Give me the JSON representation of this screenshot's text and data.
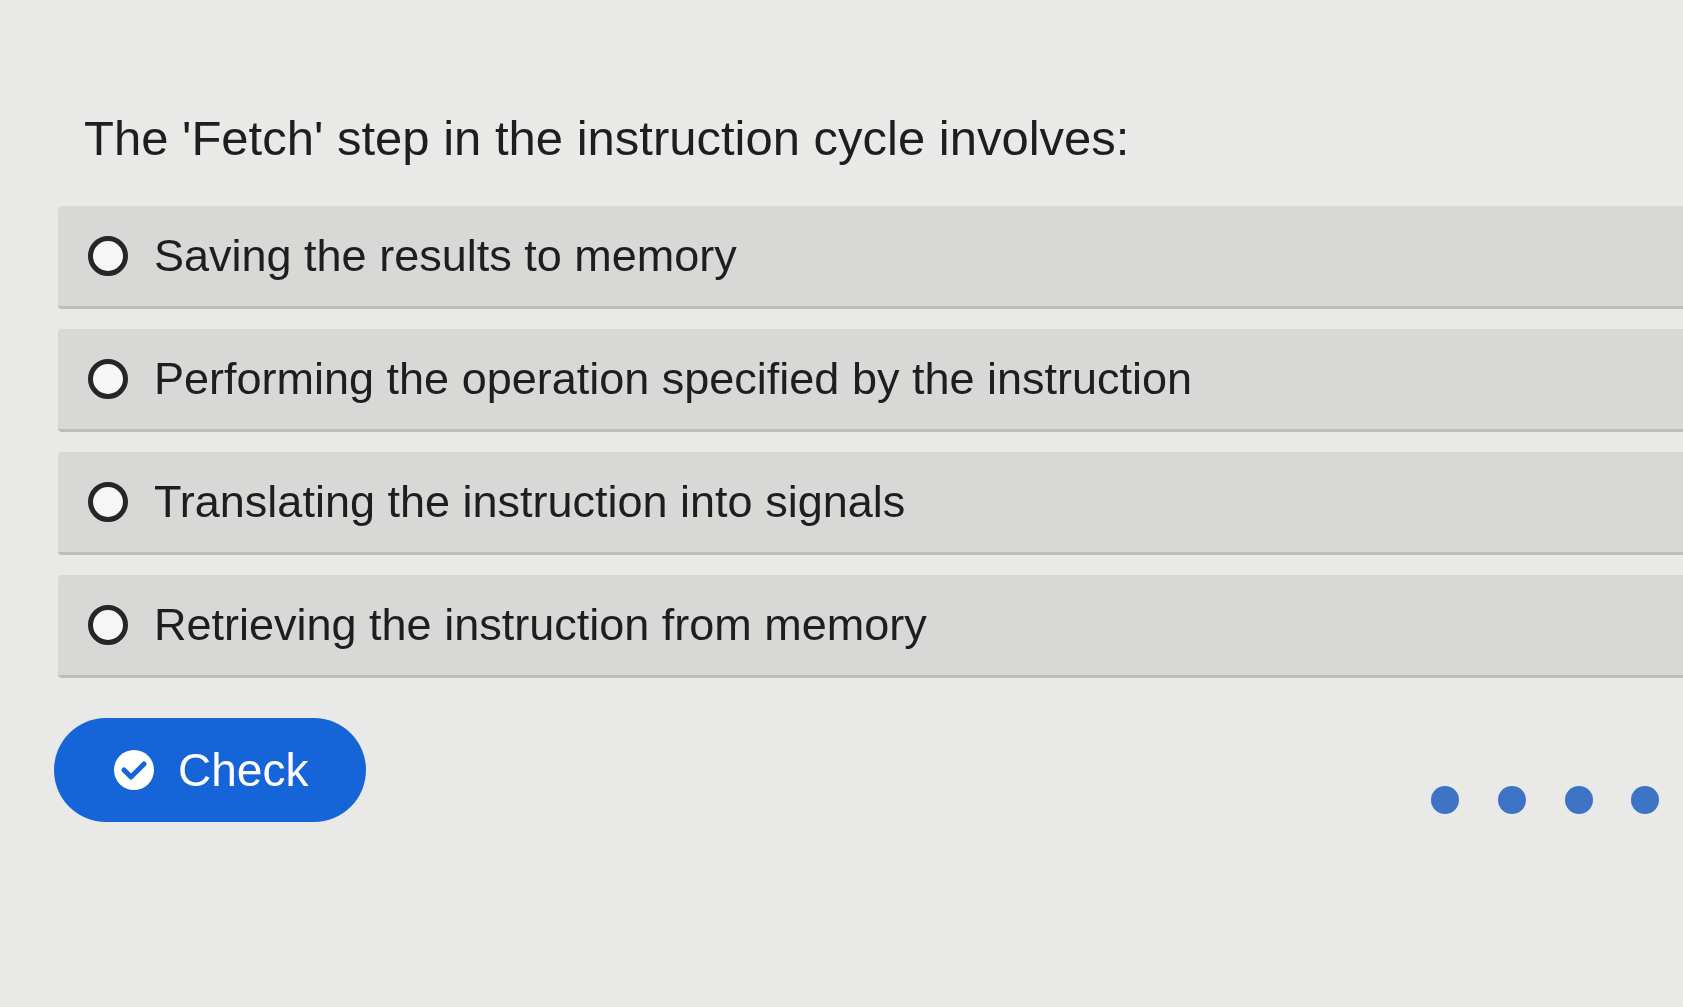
{
  "question": "The 'Fetch' step in the instruction cycle involves:",
  "options": [
    {
      "label": "Saving the results to memory",
      "selected": false
    },
    {
      "label": "Performing the operation specified by the instruction",
      "selected": false
    },
    {
      "label": "Translating the instruction into signals",
      "selected": false
    },
    {
      "label": "Retrieving the instruction from memory",
      "selected": false
    }
  ],
  "check_button": {
    "label": "Check"
  }
}
